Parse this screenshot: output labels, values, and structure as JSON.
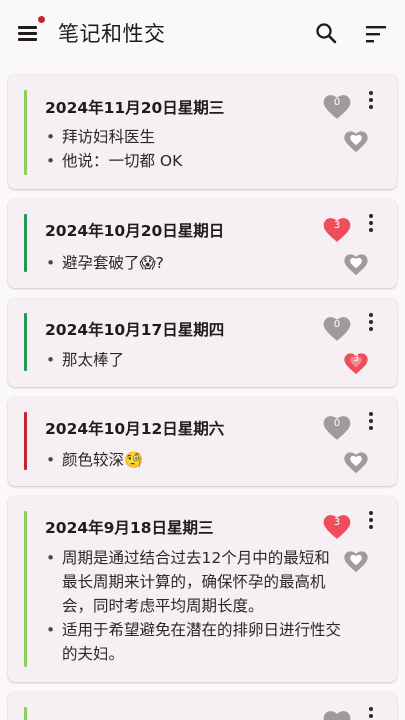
{
  "app": {
    "title": "笔记和性交"
  },
  "colors": {
    "stripe_green_light": "#8ccf5a",
    "stripe_green_dark": "#1f9a55",
    "stripe_red": "#c4232f",
    "heart_gray": "#9e9a9e",
    "heart_red": "#ee4e5b"
  },
  "icons": {
    "menu": "menu-icon",
    "search": "search-icon",
    "sort": "sort-icon",
    "more": "more-vert-icon",
    "heart": "heart-icon"
  },
  "notes": [
    {
      "date": "2024年11月20日星期三",
      "lines": [
        "拜访妇科医生",
        "他说：一切都 OK"
      ],
      "big_count": "0",
      "small_count": ""
    },
    {
      "date": "2024年10月20日星期日",
      "lines": [
        "避孕套破了😱?"
      ],
      "big_count": "3",
      "small_count": ""
    },
    {
      "date": "2024年10月17日星期四",
      "lines": [
        "那太棒了"
      ],
      "big_count": "0",
      "small_count": "3"
    },
    {
      "date": "2024年10月12日星期六",
      "lines": [
        "颜色较深🧐"
      ],
      "big_count": "0",
      "small_count": ""
    },
    {
      "date": "2024年9月18日星期三",
      "lines": [
        "周期是通过结合过去12个月中的最短和最长周期来计算的，确保怀孕的最高机会，同时考虑平均周期长度。",
        "适用于希望避免在潜在的排卵日进行性交的夫妇。"
      ],
      "big_count": "3",
      "small_count": ""
    }
  ]
}
